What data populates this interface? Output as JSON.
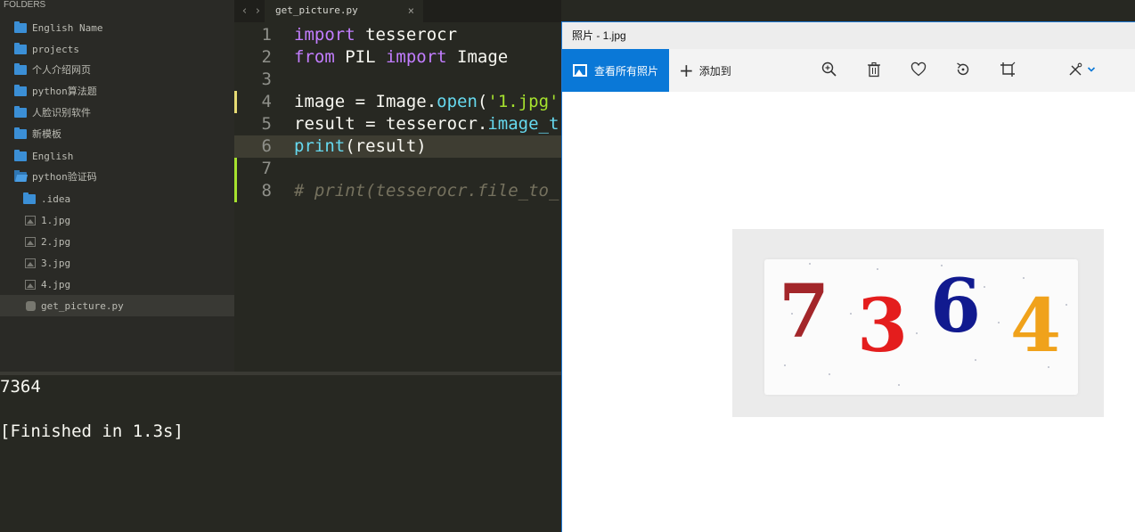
{
  "sidebar": {
    "header": "FOLDERS",
    "items": [
      {
        "label": "English Name",
        "type": "folder"
      },
      {
        "label": "projects",
        "type": "folder"
      },
      {
        "label": "个人介绍网页",
        "type": "folder"
      },
      {
        "label": "python算法题",
        "type": "folder"
      },
      {
        "label": "人脸识别软件",
        "type": "folder"
      },
      {
        "label": "新模板",
        "type": "folder"
      },
      {
        "label": "English",
        "type": "folder"
      },
      {
        "label": "python验证码",
        "type": "folder-open"
      },
      {
        "label": ".idea",
        "type": "folder"
      },
      {
        "label": "1.jpg",
        "type": "image"
      },
      {
        "label": "2.jpg",
        "type": "image"
      },
      {
        "label": "3.jpg",
        "type": "image"
      },
      {
        "label": "4.jpg",
        "type": "image"
      },
      {
        "label": "get_picture.py",
        "type": "python"
      }
    ]
  },
  "editor": {
    "tab_title": "get_picture.py",
    "close_glyph": "×",
    "nav_back": "‹",
    "nav_forward": "›",
    "line_numbers": [
      "1",
      "2",
      "3",
      "4",
      "5",
      "6",
      "7",
      "8"
    ],
    "code": {
      "l1_kw": "import",
      "l1_rest": " tesserocr",
      "l2_kw1": "from",
      "l2_mid": " PIL ",
      "l2_kw2": "import",
      "l2_rest": " Image",
      "l4_a": "image = Image.",
      "l4_fn": "open",
      "l4_b": "(",
      "l4_str": "'1.jpg'",
      "l5_a": "result = tesserocr.",
      "l5_fn": "image_t",
      "l6_fn": "print",
      "l6_rest": "(result)",
      "l8_comment": "# print(tesserocr.file_to_"
    }
  },
  "output": {
    "line1": "7364",
    "line2": "[Finished in 1.3s]"
  },
  "photos": {
    "title": "照片 - 1.jpg",
    "view_all_label": "查看所有照片",
    "add_to_label": "添加到",
    "toolbar_icons": [
      "zoom-in-icon",
      "delete-icon",
      "favorite-icon",
      "rotate-icon",
      "crop-icon",
      "edit-icon"
    ],
    "captcha_digits": [
      "7",
      "3",
      "6",
      "4"
    ],
    "digit_colors": [
      "#a3262a",
      "#e41d1d",
      "#111a8f",
      "#f0a21b"
    ]
  }
}
